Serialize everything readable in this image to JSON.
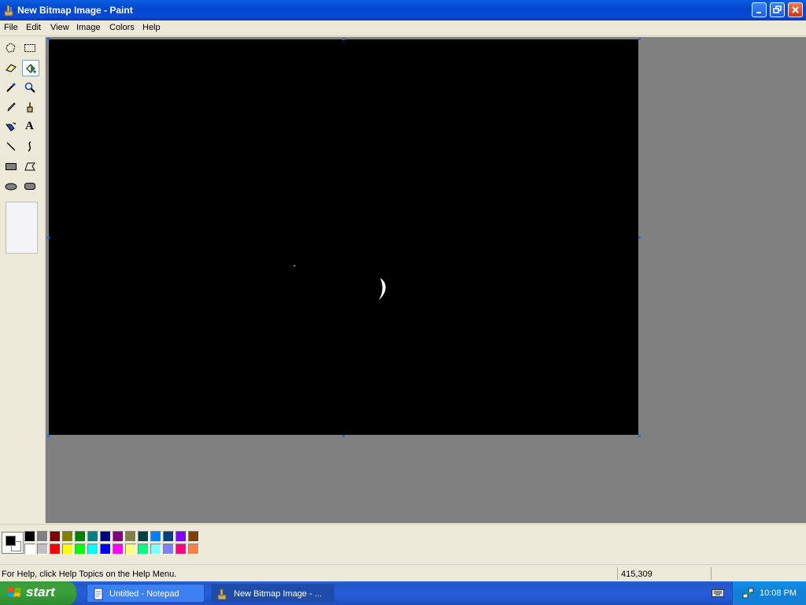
{
  "window": {
    "title": "New Bitmap Image - Paint"
  },
  "menu": [
    "File",
    "Edit",
    "View",
    "Image",
    "Colors",
    "Help"
  ],
  "tools": [
    {
      "name": "free-form-select-icon"
    },
    {
      "name": "rect-select-icon"
    },
    {
      "name": "eraser-icon"
    },
    {
      "name": "fill-bucket-icon",
      "selected": true
    },
    {
      "name": "pick-color-icon"
    },
    {
      "name": "magnifier-icon"
    },
    {
      "name": "pencil-icon"
    },
    {
      "name": "brush-icon"
    },
    {
      "name": "airbrush-icon"
    },
    {
      "name": "text-icon",
      "glyph": "A"
    },
    {
      "name": "line-icon"
    },
    {
      "name": "curve-icon"
    },
    {
      "name": "rectangle-icon"
    },
    {
      "name": "polygon-icon"
    },
    {
      "name": "ellipse-icon"
    },
    {
      "name": "rounded-rect-icon"
    }
  ],
  "palette": {
    "foreground": "#000000",
    "background": "#ffffff",
    "row1": [
      "#000000",
      "#808080",
      "#800000",
      "#808000",
      "#008000",
      "#008080",
      "#000080",
      "#800080",
      "#808040",
      "#004040",
      "#0080ff",
      "#004080",
      "#8000ff",
      "#804000"
    ],
    "row2": [
      "#ffffff",
      "#c0c0c0",
      "#ff0000",
      "#ffff00",
      "#00ff00",
      "#00ffff",
      "#0000ff",
      "#ff00ff",
      "#ffff80",
      "#00ff80",
      "#80ffff",
      "#8080ff",
      "#ff0080",
      "#ff8040"
    ]
  },
  "status": {
    "help": "For Help, click Help Topics on the Help Menu.",
    "coords": "415,309"
  },
  "taskbar": {
    "start": "start",
    "tasks": [
      {
        "label": "Untitled - Notepad",
        "active": false
      },
      {
        "label": "New Bitmap Image - ...",
        "active": true
      }
    ],
    "clock": "10:08 PM"
  }
}
